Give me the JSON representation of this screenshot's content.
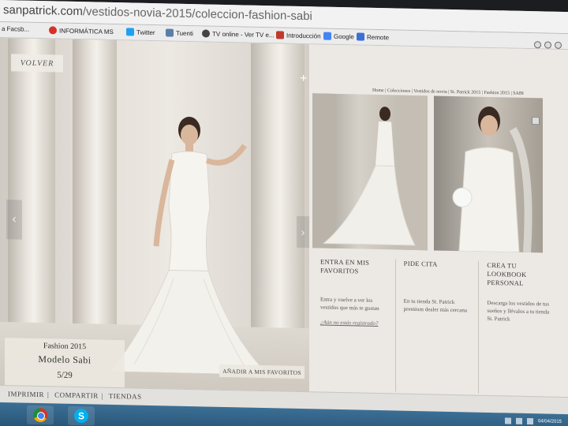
{
  "browser": {
    "url_host": "sanpatrick.com",
    "url_path": "/vestidos-novia-2015/coleccion-fashion-sabi"
  },
  "bookmarks": [
    {
      "label": "a Facsb...",
      "color": "#999999"
    },
    {
      "label": "INFORMÁTICA MS",
      "color": "#d93025"
    },
    {
      "label": "Twitter",
      "color": "#1da1f2"
    },
    {
      "label": "Tuenti",
      "color": "#5b7ea8"
    },
    {
      "label": "TV online - Ver TV e...",
      "color": "#444444"
    },
    {
      "label": "Introducción",
      "color": "#c0392b"
    },
    {
      "label": "Google",
      "color": "#4285f4"
    },
    {
      "label": "Remote",
      "color": "#3b6fd6"
    }
  ],
  "hero": {
    "back_label": "VOLVER",
    "collection": "Fashion 2015",
    "model": "Modelo Sabi",
    "counter": "5/29",
    "fav_button": "AÑADIR A MIS FAVORITOS"
  },
  "breadcrumb": "Home | Colecciones | Vestidos de novia | St. Patrick 2015 | Fashion 2015 | SABI",
  "features": [
    {
      "title": "ENTRA EN MIS FAVORITOS",
      "desc": "Entra y vuelve a ver los vestidos que más te gustan",
      "link": "¿Aún no estás registrado?"
    },
    {
      "title": "PIDE CITA",
      "desc": "En tu tienda St. Patrick premium dealer más cercana",
      "link": ""
    },
    {
      "title": "CREA TU LOOKBOOK PERSONAL",
      "desc": "Descarga los vestidos de tus sueños y llévalos a tu tienda St. Patrick",
      "link": ""
    }
  ],
  "footer": {
    "links": [
      "IMPRIMIR",
      "COMPARTIR",
      "TIENDAS"
    ]
  },
  "taskbar": {
    "apps": [
      "chrome",
      "skype"
    ],
    "time": "",
    "date": "04/04/2015"
  }
}
